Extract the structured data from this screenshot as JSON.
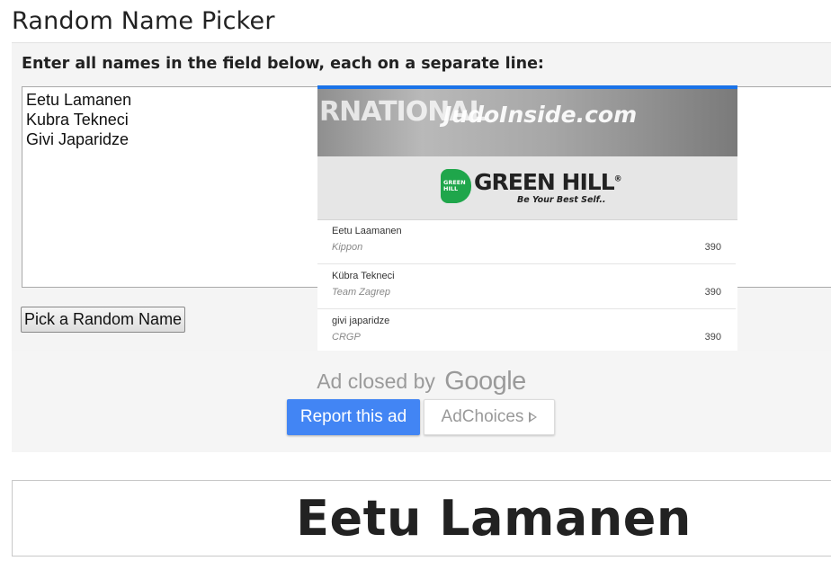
{
  "page": {
    "title": "Random Name Picker"
  },
  "picker": {
    "instructions": "Enter all names in the field below, each on a separate line:",
    "names_value": "Eetu Lamanen\nKubra Tekneci\nGivi Japaridze",
    "button_label": "Pick a Random Name"
  },
  "ad": {
    "banner_text": "RNATIONAL",
    "site_name": "JudoInside.com",
    "sponsor_logo_text": "GREEN HILL",
    "sponsor_brand": "GREEN HILL",
    "sponsor_mark": "®",
    "sponsor_tagline": "Be Your Best Self..",
    "accent_color": "#1a73e8",
    "rows": [
      {
        "name": "Eetu Laamanen",
        "team": "Kippon",
        "points": "390"
      },
      {
        "name": "Kübra Tekneci",
        "team": "Team Zagrep",
        "points": "390"
      },
      {
        "name": "givi japaridze",
        "team": "CRGP",
        "points": "390"
      }
    ]
  },
  "ad_closed": {
    "prefix": "Ad closed by",
    "brand": "Google",
    "report_label": "Report this ad",
    "adchoices_label": "AdChoices",
    "report_color": "#4285f4"
  },
  "result": {
    "name": "Eetu Lamanen"
  }
}
